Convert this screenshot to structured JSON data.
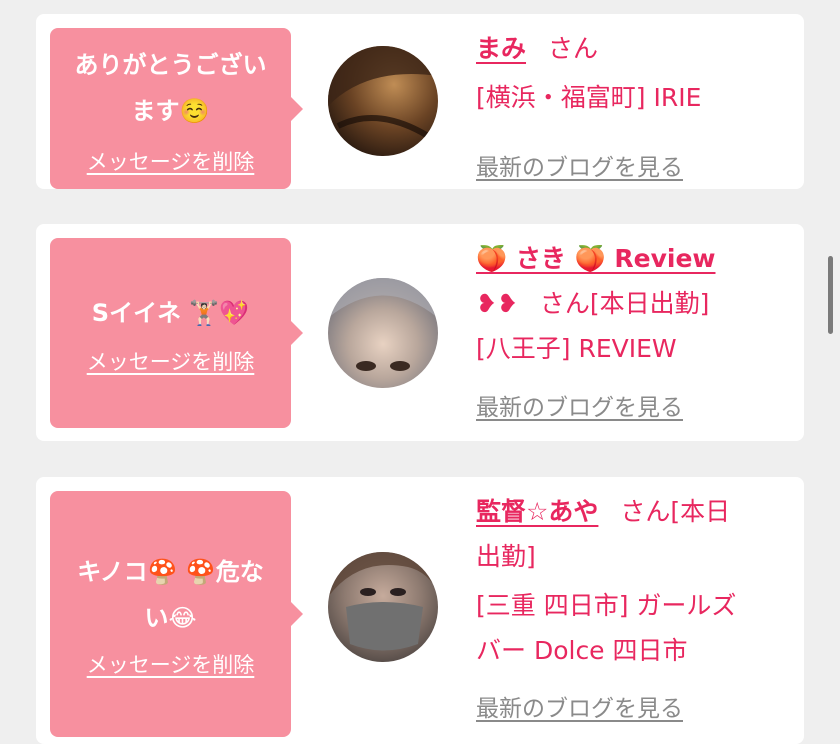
{
  "messages": [
    {
      "message_lines": [
        "ありがとうござい",
        "ます☺️"
      ],
      "delete_label": "メッセージを削除",
      "name": "まみ",
      "honorific": "さん",
      "location_lines": [
        "[横浜・福富町] IRIE"
      ],
      "blog_link": "最新のブログを見る"
    },
    {
      "message_lines": [
        "Sイイネ 🏋🏻💖"
      ],
      "delete_label": "メッセージを削除",
      "name": "🍑 さき 🍑 Review",
      "name_cont": "❥❥",
      "honorific": "さん[本日出勤]",
      "location_lines": [
        "[八王子] REVIEW"
      ],
      "blog_link": "最新のブログを見る"
    },
    {
      "message_lines": [
        "キノコ🍄 🍄危な",
        "い😂"
      ],
      "delete_label": "メッセージを削除",
      "name": "監督☆あや",
      "honorific": "さん[本日",
      "honorific_cont": "出勤]",
      "location_lines": [
        "[三重 四日市] ガールズ",
        "バー Dolce 四日市"
      ],
      "blog_link": "最新のブログを見る"
    }
  ],
  "colors": {
    "accent": "#e8275f",
    "bubble": "#f7909f",
    "link_gray": "#8a8a8a",
    "background": "#efefef"
  }
}
